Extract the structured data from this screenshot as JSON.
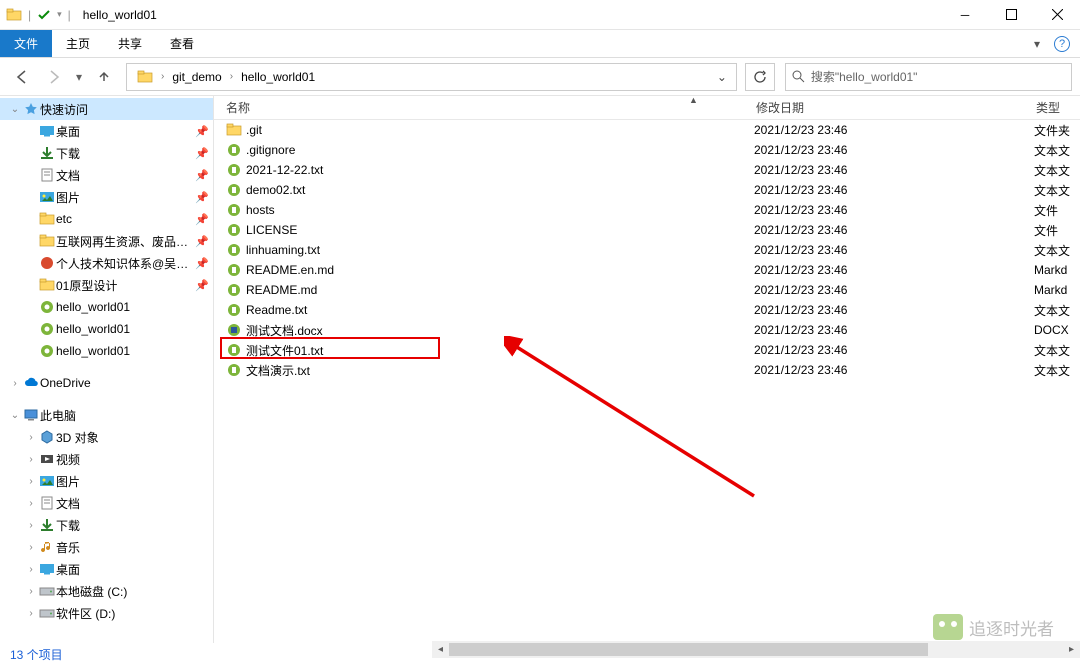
{
  "title": "hello_world01",
  "ribbon": {
    "file": "文件",
    "tabs": [
      "主页",
      "共享",
      "查看"
    ]
  },
  "nav": {
    "breadcrumb": [
      "git_demo",
      "hello_world01"
    ],
    "search_placeholder": "搜索\"hello_world01\""
  },
  "sidebar": {
    "quick_access": "快速访问",
    "quick_items": [
      {
        "label": "桌面",
        "icon": "desktop",
        "pin": true
      },
      {
        "label": "下载",
        "icon": "download",
        "pin": true
      },
      {
        "label": "文档",
        "icon": "docs",
        "pin": true
      },
      {
        "label": "图片",
        "icon": "pictures",
        "pin": true
      },
      {
        "label": "etc",
        "icon": "folder",
        "pin": true
      },
      {
        "label": "互联网再生资源、废品回收",
        "icon": "folder",
        "pin": true
      },
      {
        "label": "个人技术知识体系@吴川生",
        "icon": "red",
        "pin": true
      },
      {
        "label": "01原型设计",
        "icon": "folder",
        "pin": true
      },
      {
        "label": "hello_world01",
        "icon": "git",
        "pin": false
      },
      {
        "label": "hello_world01",
        "icon": "git",
        "pin": false
      },
      {
        "label": "hello_world01",
        "icon": "git",
        "pin": false
      }
    ],
    "onedrive": "OneDrive",
    "thispc": "此电脑",
    "pc_items": [
      {
        "label": "3D 对象",
        "icon": "3d"
      },
      {
        "label": "视频",
        "icon": "video"
      },
      {
        "label": "图片",
        "icon": "pictures"
      },
      {
        "label": "文档",
        "icon": "docs"
      },
      {
        "label": "下载",
        "icon": "download"
      },
      {
        "label": "音乐",
        "icon": "music"
      },
      {
        "label": "桌面",
        "icon": "desktop"
      },
      {
        "label": "本地磁盘 (C:)",
        "icon": "drive"
      },
      {
        "label": "软件区 (D:)",
        "icon": "drive"
      }
    ]
  },
  "columns": {
    "name": "名称",
    "date": "修改日期",
    "type": "类型"
  },
  "files": [
    {
      "name": ".git",
      "date": "2021/12/23 23:46",
      "type": "文件夹",
      "icon": "folder"
    },
    {
      "name": ".gitignore",
      "date": "2021/12/23 23:46",
      "type": "文本文",
      "icon": "txt"
    },
    {
      "name": "2021-12-22.txt",
      "date": "2021/12/23 23:46",
      "type": "文本文",
      "icon": "txt"
    },
    {
      "name": "demo02.txt",
      "date": "2021/12/23 23:46",
      "type": "文本文",
      "icon": "txt"
    },
    {
      "name": "hosts",
      "date": "2021/12/23 23:46",
      "type": "文件",
      "icon": "txt"
    },
    {
      "name": "LICENSE",
      "date": "2021/12/23 23:46",
      "type": "文件",
      "icon": "txt"
    },
    {
      "name": "linhuaming.txt",
      "date": "2021/12/23 23:46",
      "type": "文本文",
      "icon": "txt"
    },
    {
      "name": "README.en.md",
      "date": "2021/12/23 23:46",
      "type": "Markd",
      "icon": "txt"
    },
    {
      "name": "README.md",
      "date": "2021/12/23 23:46",
      "type": "Markd",
      "icon": "txt"
    },
    {
      "name": "Readme.txt",
      "date": "2021/12/23 23:46",
      "type": "文本文",
      "icon": "txt"
    },
    {
      "name": "测试文档.docx",
      "date": "2021/12/23 23:46",
      "type": "DOCX",
      "icon": "docx"
    },
    {
      "name": "测试文件01.txt",
      "date": "2021/12/23 23:46",
      "type": "文本文",
      "icon": "txt"
    },
    {
      "name": "文档演示.txt",
      "date": "2021/12/23 23:46",
      "type": "文本文",
      "icon": "txt"
    }
  ],
  "status": "13 个项目",
  "watermark": "追逐时光者",
  "highlight_row": 11
}
